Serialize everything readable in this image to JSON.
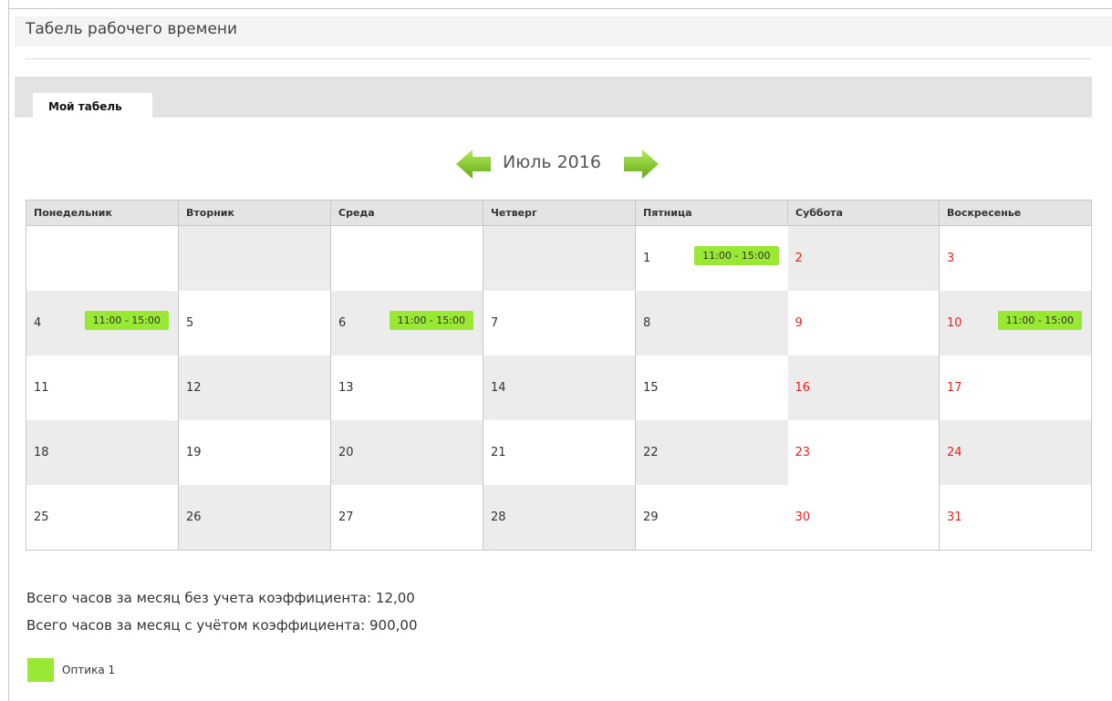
{
  "page": {
    "title": "Табель рабочего времени"
  },
  "tabs": [
    {
      "label": "Мой табель",
      "active": true
    }
  ],
  "calendar": {
    "month_label": "Июль 2016",
    "weekdays": [
      "Понедельник",
      "Вторник",
      "Среда",
      "Четверг",
      "Пятница",
      "Суббота",
      "Воскресенье"
    ],
    "weeks": [
      [
        {
          "day": "",
          "shift": ""
        },
        {
          "day": "",
          "shift": ""
        },
        {
          "day": "",
          "shift": ""
        },
        {
          "day": "",
          "shift": ""
        },
        {
          "day": "1",
          "shift": "11:00 - 15:00"
        },
        {
          "day": "2",
          "shift": ""
        },
        {
          "day": "3",
          "shift": ""
        }
      ],
      [
        {
          "day": "4",
          "shift": "11:00 - 15:00"
        },
        {
          "day": "5",
          "shift": ""
        },
        {
          "day": "6",
          "shift": "11:00 - 15:00"
        },
        {
          "day": "7",
          "shift": ""
        },
        {
          "day": "8",
          "shift": ""
        },
        {
          "day": "9",
          "shift": ""
        },
        {
          "day": "10",
          "shift": "11:00 - 15:00"
        }
      ],
      [
        {
          "day": "11",
          "shift": ""
        },
        {
          "day": "12",
          "shift": ""
        },
        {
          "day": "13",
          "shift": ""
        },
        {
          "day": "14",
          "shift": ""
        },
        {
          "day": "15",
          "shift": ""
        },
        {
          "day": "16",
          "shift": ""
        },
        {
          "day": "17",
          "shift": ""
        }
      ],
      [
        {
          "day": "18",
          "shift": ""
        },
        {
          "day": "19",
          "shift": ""
        },
        {
          "day": "20",
          "shift": ""
        },
        {
          "day": "21",
          "shift": ""
        },
        {
          "day": "22",
          "shift": ""
        },
        {
          "day": "23",
          "shift": ""
        },
        {
          "day": "24",
          "shift": ""
        }
      ],
      [
        {
          "day": "25",
          "shift": ""
        },
        {
          "day": "26",
          "shift": ""
        },
        {
          "day": "27",
          "shift": ""
        },
        {
          "day": "28",
          "shift": ""
        },
        {
          "day": "29",
          "shift": ""
        },
        {
          "day": "30",
          "shift": ""
        },
        {
          "day": "31",
          "shift": ""
        }
      ]
    ]
  },
  "totals": {
    "without_coef": "Всего часов за месяц без учета коэффициента: 12,00",
    "with_coef": "Всего часов за месяц с учётом коэффициента: 900,00"
  },
  "legend": [
    {
      "label": "Оптика 1",
      "color": "#99e833"
    }
  ],
  "colors": {
    "shift": "#99e833",
    "weekend_text": "#e8231d",
    "arrow": "#7dc51e"
  },
  "icons": {
    "prev": "arrow-left-icon",
    "next": "arrow-right-icon"
  }
}
